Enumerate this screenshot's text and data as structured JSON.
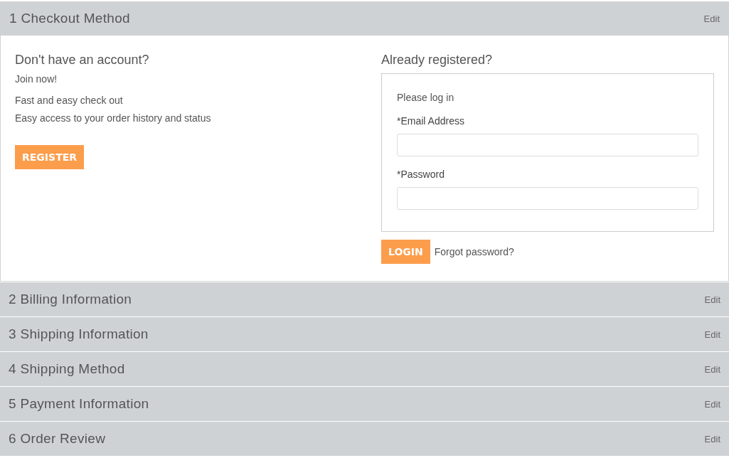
{
  "steps": [
    {
      "title": "1 Checkout Method",
      "edit": "Edit",
      "expanded": true
    },
    {
      "title": "2 Billing Information",
      "edit": "Edit",
      "expanded": false
    },
    {
      "title": "3 Shipping Information",
      "edit": "Edit",
      "expanded": false
    },
    {
      "title": "4 Shipping Method",
      "edit": "Edit",
      "expanded": false
    },
    {
      "title": "5 Payment Information",
      "edit": "Edit",
      "expanded": false
    },
    {
      "title": "6 Order Review",
      "edit": "Edit",
      "expanded": false
    }
  ],
  "new_customer": {
    "heading": "Don't have an account?",
    "intro": "Join now!",
    "benefits": [
      "Fast and easy check out",
      "Easy access to your order history and status"
    ],
    "button": "REGISTER"
  },
  "login": {
    "heading": "Already registered?",
    "prompt": "Please log in",
    "fields": [
      {
        "label": "*Email Address"
      },
      {
        "label": "*Password"
      }
    ],
    "button": "LOGIN",
    "forgot_link": "Forgot password?"
  }
}
